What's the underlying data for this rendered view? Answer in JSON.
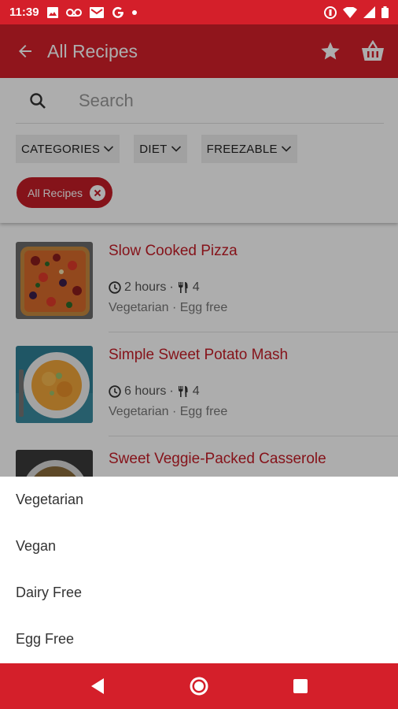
{
  "status_bar": {
    "time": "11:39",
    "notification_icons": [
      "image-icon",
      "voicemail-icon",
      "gmail-icon",
      "google-icon",
      "dot-icon"
    ],
    "system_icons": [
      "dnd-icon",
      "wifi-icon",
      "signal-icon",
      "battery-icon"
    ]
  },
  "app_bar": {
    "title": "All Recipes",
    "back_icon": "arrow-back-icon",
    "actions": [
      "star-icon",
      "basket-icon"
    ]
  },
  "search": {
    "placeholder": "Search",
    "value": ""
  },
  "filters": {
    "dropdowns": [
      {
        "label": "CATEGORIES"
      },
      {
        "label": "DIET"
      },
      {
        "label": "FREEZABLE"
      }
    ],
    "active_chip": {
      "label": "All Recipes"
    }
  },
  "recipes": [
    {
      "title": "Slow Cooked Pizza",
      "time": "2 hours",
      "servings": "4",
      "separator": "·",
      "tags": "Vegetarian · Egg free"
    },
    {
      "title": "Simple Sweet Potato Mash",
      "time": "6 hours",
      "servings": "4",
      "separator": "·",
      "tags": "Vegetarian · Egg free"
    },
    {
      "title": "Sweet Veggie-Packed Casserole",
      "time": "",
      "servings": "",
      "separator": "",
      "tags": ""
    }
  ],
  "diet_options": [
    {
      "label": "Vegetarian"
    },
    {
      "label": "Vegan"
    },
    {
      "label": "Dairy Free"
    },
    {
      "label": "Egg Free"
    }
  ],
  "colors": {
    "brand_red": "#d41f2a",
    "chip_red": "#c51d27",
    "title_red": "#c51d27"
  },
  "nav_bar": {
    "buttons": [
      "back-triangle-icon",
      "home-circle-icon",
      "recents-square-icon"
    ]
  }
}
